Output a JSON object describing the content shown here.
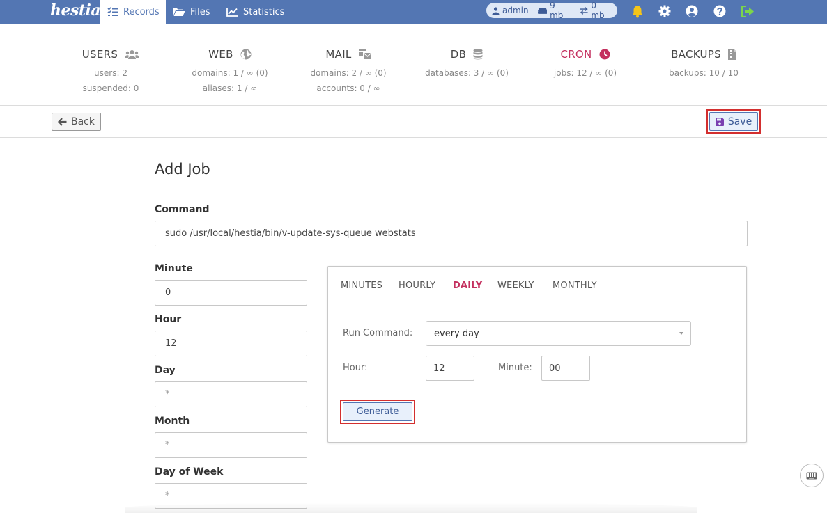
{
  "brand": {
    "logo_text": "hestia"
  },
  "nav": {
    "records_label": "Records",
    "files_label": "Files",
    "statistics_label": "Statistics"
  },
  "user_pill": {
    "username": "admin",
    "disk": "9 mb",
    "bandwidth": "0 mb"
  },
  "stats": [
    {
      "title": "USERS",
      "line1": "users: 2",
      "line2": "suspended: 0"
    },
    {
      "title": "WEB",
      "line1": "domains: 1 / ∞ (0)",
      "line2": "aliases: 1 / ∞"
    },
    {
      "title": "MAIL",
      "line1": "domains: 2 / ∞ (0)",
      "line2": "accounts: 0 / ∞"
    },
    {
      "title": "DB",
      "line1": "databases: 3 / ∞ (0)",
      "line2": ""
    },
    {
      "title": "CRON",
      "line1": "jobs: 12 / ∞ (0)",
      "line2": ""
    },
    {
      "title": "BACKUPS",
      "line1": "backups: 10 / 10",
      "line2": ""
    }
  ],
  "toolbar": {
    "back_label": "Back",
    "save_label": "Save"
  },
  "form": {
    "title": "Add Job",
    "command_label": "Command",
    "command_value": "sudo /usr/local/hestia/bin/v-update-sys-queue webstats",
    "minute_label": "Minute",
    "minute_value": "0",
    "hour_label": "Hour",
    "hour_value": "12",
    "day_label": "Day",
    "day_value": "*",
    "month_label": "Month",
    "month_value": "*",
    "dow_label": "Day of Week",
    "dow_value": "*"
  },
  "generator": {
    "tabs": [
      "MINUTES",
      "HOURLY",
      "DAILY",
      "WEEKLY",
      "MONTHLY"
    ],
    "active_tab": "DAILY",
    "run_command_label": "Run Command:",
    "run_command_value": "every day",
    "hour_label": "Hour:",
    "hour_value": "12",
    "minute_label": "Minute:",
    "minute_value": "00",
    "generate_label": "Generate"
  },
  "colors": {
    "topbar": "#5376b3",
    "accent": "#c4305f",
    "highlight_border": "#d32f2f",
    "bell": "#f5c518",
    "logout": "#7cd64a"
  },
  "icons": {
    "records": "list-check-icon",
    "files": "folder-icon",
    "statistics": "line-chart-icon",
    "notifications": "bell-icon",
    "settings": "gear-icon",
    "profile": "user-circle-icon",
    "help": "question-circle-icon",
    "logout": "logout-icon"
  }
}
